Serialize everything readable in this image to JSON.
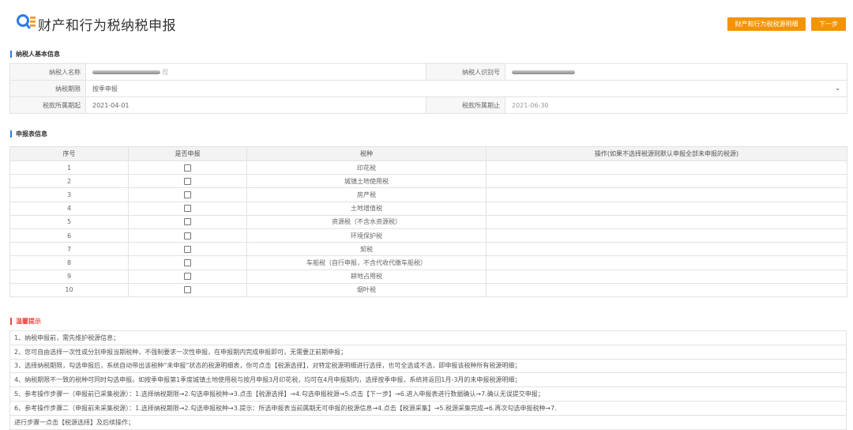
{
  "header": {
    "title": "财产和行为税纳税申报",
    "detail_button": "财产和行为税税源明细",
    "next_button": "下一步"
  },
  "taxpayer_section": {
    "title": "纳税人基本信息",
    "name_label": "纳税人名称",
    "name_suffix": "司",
    "id_label": "纳税人识别号",
    "period_label": "纳税期限",
    "period_value": "按季申报",
    "start_label": "税款所属期起",
    "start_value": "2021-04-01",
    "end_label": "税款所属期止",
    "end_value": "2021-06-30"
  },
  "declaration_section": {
    "title": "申报表信息",
    "columns": [
      "序号",
      "是否申报",
      "税种",
      "操作(如果不选择税源则默认申报全部未申报的税源)"
    ],
    "rows": [
      {
        "no": "1",
        "tax": "印花税"
      },
      {
        "no": "2",
        "tax": "城镇土地使用税"
      },
      {
        "no": "3",
        "tax": "房产税"
      },
      {
        "no": "4",
        "tax": "土地增值税"
      },
      {
        "no": "5",
        "tax": "资源税（不含水资源税）"
      },
      {
        "no": "6",
        "tax": "环境保护税"
      },
      {
        "no": "7",
        "tax": "契税"
      },
      {
        "no": "8",
        "tax": "车船税（自行申报，不含代收代缴车船税）"
      },
      {
        "no": "9",
        "tax": "耕地占用税"
      },
      {
        "no": "10",
        "tax": "烟叶税"
      }
    ]
  },
  "tips_section": {
    "title": "温馨提示",
    "items": [
      "1、纳税申报前，需先维护税源信息；",
      "2、您可自由选择一次性或分别申报当期税种，不强制要求一次性申报，在申报期内完成申报即可，无需要正前期申报；",
      "3、选择纳税期限，勾选申报后，系统自动带出该税种“未申报”状态的税源明细表，你可点击【税源选择】，对特定税源明细进行选择，也可全选或不选，即申报该税种所有税源明细；",
      "4、纳税期限不一致的税种可同时勾选申报。如按季申报第1季度城镇土地使用税与按月申报3月印花税，均可在4月申报期内，选择按季申报，系统将返回1月-3月的未申报税源明细；",
      "5、参考操作步骤一（申报前已采集税源）：1.选择纳税期限→2.勾选申报税种→3.点击【税源选择】→4.勾选申报税源→5.点击【下一步】→6.进入申报表进行数据确认→7.确认无误提交申报；",
      "6、参考操作步骤二（申报前未采集税源）：1.选择纳税期限→2.勾选申报税种→3.提示：所选申报表当前属期无可申报的税源信息→4.点击【税源采集】→5.税源采集完成→6.再次勾选申报税种→7.",
      "进行步骤一点击【税源选择】及后续操作；"
    ]
  },
  "colors": {
    "accent": "#f39400",
    "section_marker": "#2d7be5",
    "warning": "#e8463c"
  },
  "icons": {
    "logo": "search-document-icon",
    "dropdown": "chevron-down-icon",
    "checkbox": "checkbox-icon"
  }
}
